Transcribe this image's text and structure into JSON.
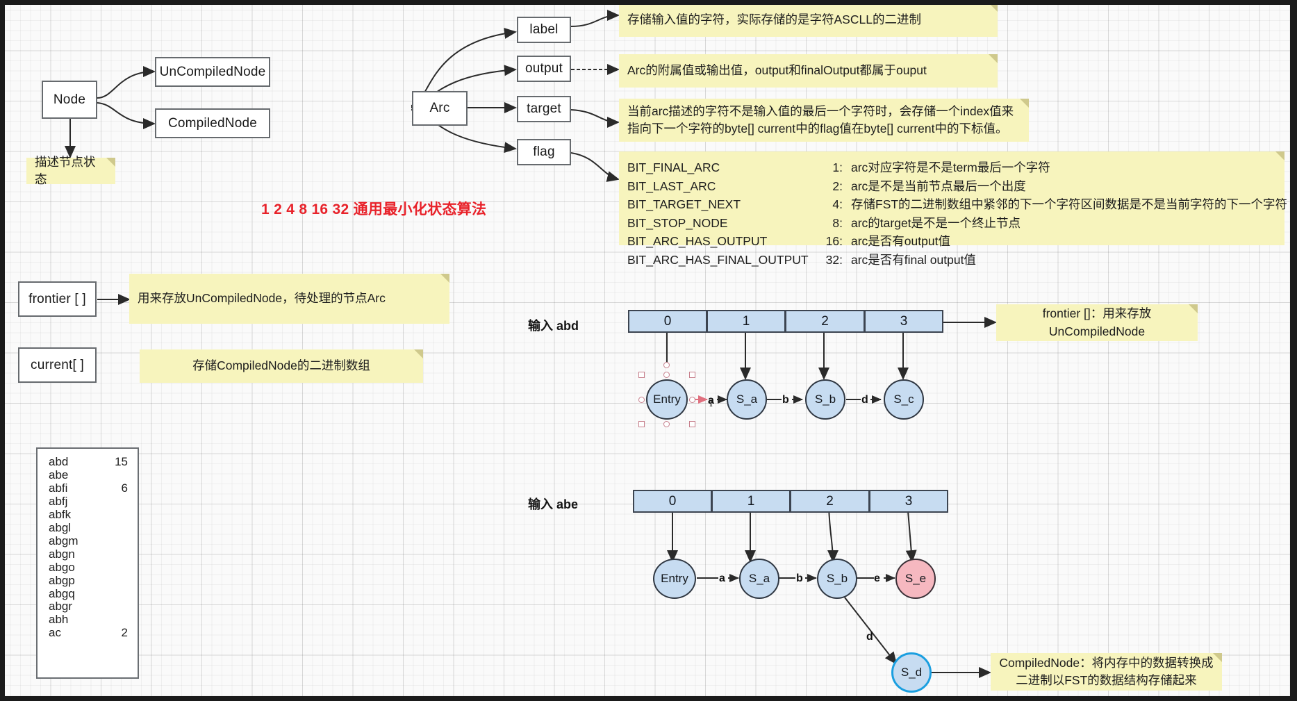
{
  "title_red": "1 2 4 8 16 32 通用最小化状态算法",
  "node_section": {
    "root": "Node",
    "children": [
      "UnCompiledNode",
      "CompiledNode"
    ],
    "note": "描述节点状态"
  },
  "arc_section": {
    "root": "Arc",
    "fields": [
      "label",
      "output",
      "target",
      "flag"
    ],
    "notes": {
      "label": "存储输入值的字符，实际存储的是字符ASCLL的二进制",
      "output": "Arc的附属值或输出值，output和finalOutput都属于ouput",
      "target_line1": "当前arc描述的字符不是输入值的最后一个字符时，会存储一个index值来",
      "target_line2": "指向下一个字符的byte[] current中的flag值在byte[] current中的下标值。"
    },
    "flags": [
      {
        "name": "BIT_FINAL_ARC",
        "value": "1:",
        "desc": "arc对应字符是不是term最后一个字符"
      },
      {
        "name": "BIT_LAST_ARC",
        "value": "2:",
        "desc": "arc是不是当前节点最后一个出度"
      },
      {
        "name": "BIT_TARGET_NEXT",
        "value": "4:",
        "desc": "存储FST的二进制数组中紧邻的下一个字符区间数据是不是当前字符的下一个字符"
      },
      {
        "name": "BIT_STOP_NODE",
        "value": "8:",
        "desc": "arc的target是不是一个终止节点"
      },
      {
        "name": "BIT_ARC_HAS_OUTPUT",
        "value": "16:",
        "desc": "arc是否有output值"
      },
      {
        "name": "BIT_ARC_HAS_FINAL_OUTPUT",
        "value": "32:",
        "desc": "arc是否有final output值"
      }
    ]
  },
  "storage_section": {
    "frontier_box": "frontier [ ]",
    "frontier_note": "用来存放UnCompiledNode，待处理的节点Arc",
    "current_box": "current[ ]",
    "current_note": "存储CompiledNode的二进制数组"
  },
  "word_list": [
    {
      "word": "abd",
      "value": "15"
    },
    {
      "word": "abe",
      "value": ""
    },
    {
      "word": "abfi",
      "value": "6"
    },
    {
      "word": "abfj",
      "value": ""
    },
    {
      "word": "abfk",
      "value": ""
    },
    {
      "word": "abgl",
      "value": ""
    },
    {
      "word": "abgm",
      "value": ""
    },
    {
      "word": "abgn",
      "value": ""
    },
    {
      "word": "abgo",
      "value": ""
    },
    {
      "word": "abgp",
      "value": ""
    },
    {
      "word": "abgq",
      "value": ""
    },
    {
      "word": "abgr",
      "value": ""
    },
    {
      "word": "abh",
      "value": ""
    },
    {
      "word": "ac",
      "value": "2"
    }
  ],
  "fst_abd": {
    "input_label": "输入 abd",
    "cells": [
      "0",
      "1",
      "2",
      "3"
    ],
    "nodes": [
      "Entry",
      "S_a",
      "S_b",
      "S_c"
    ],
    "edges": [
      "a",
      "b",
      "d"
    ],
    "note_line1": "frontier []：用来存放",
    "note_line2": "UnCompiledNode"
  },
  "fst_abe": {
    "input_label": "输入 abe",
    "cells": [
      "0",
      "1",
      "2",
      "3"
    ],
    "nodes": [
      "Entry",
      "S_a",
      "S_b",
      "S_e"
    ],
    "edges": [
      "a",
      "b",
      "e"
    ],
    "branch_node": "S_d",
    "branch_edge": "d",
    "note_line1": "CompiledNode：将内存中的数据转换成",
    "note_line2": "二进制以FST的数据结构存储起来"
  },
  "colors": {
    "note_bg": "#f7f4bd",
    "cell_blue": "#c7dcf1",
    "node_pink": "#f6b8c0",
    "accent_red": "#e8222a",
    "highlight_blue": "#1b9fe0"
  }
}
